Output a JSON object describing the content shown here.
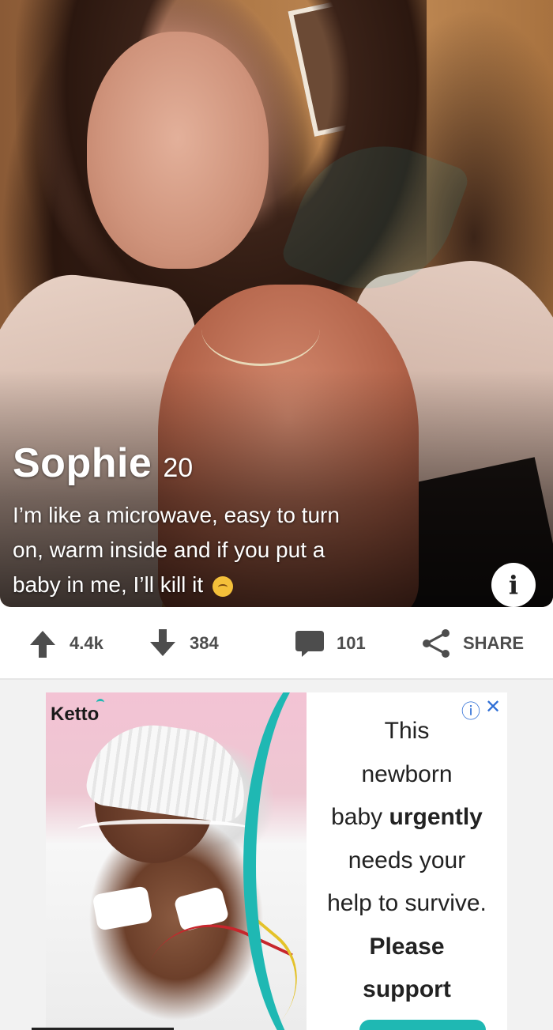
{
  "profile": {
    "name": "Sophie",
    "age": "20",
    "bio_line1": "I’m like a microwave, easy to turn",
    "bio_line2": "on, warm inside and if you put a",
    "bio_line3": "baby in me, I’ll kill it",
    "emoji": "upside-down-face-emoji",
    "info_label": "i"
  },
  "actions": {
    "upvotes": "4.4k",
    "downvotes": "384",
    "comments": "101",
    "share_label": "SHARE"
  },
  "ad": {
    "brand": "Ketto",
    "line1": "This",
    "line2": "newborn",
    "line3_pre": "baby ",
    "line3_bold": "urgently",
    "line4": "needs your",
    "line5": "help to survive.",
    "line6": "Please",
    "line7": "support",
    "info_icon": "ⓘ",
    "close_icon": "✕"
  },
  "colors": {
    "accent": "#1fb8b3",
    "action_text": "#4d4d4d",
    "ad_controls": "#2f6fd6"
  }
}
